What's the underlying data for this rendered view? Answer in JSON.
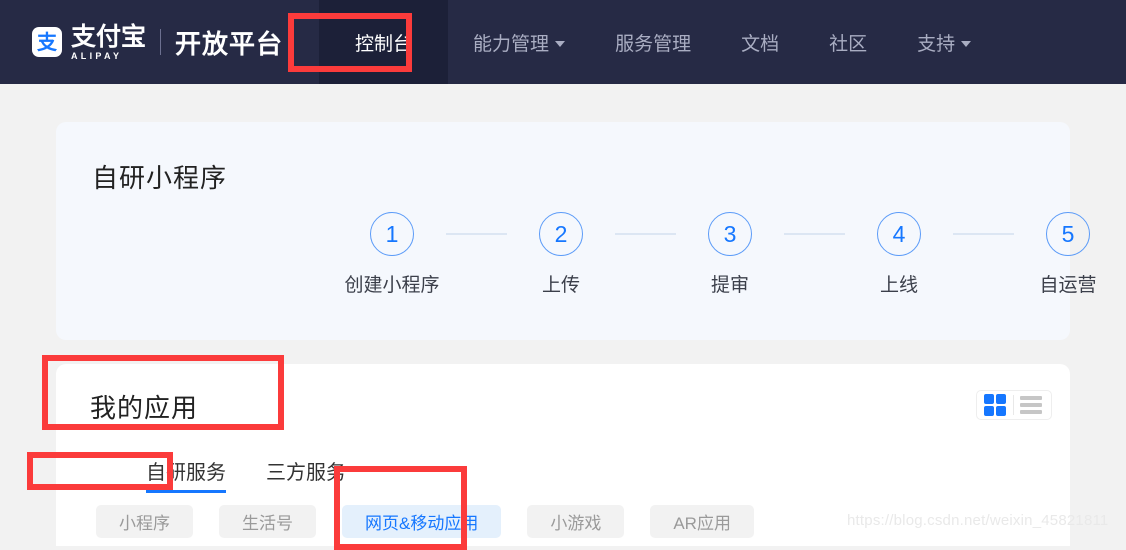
{
  "header": {
    "brand": {
      "logo_icon": "alipay-logo-icon",
      "logo_glyph": "支",
      "name_zh": "支付宝",
      "name_en": "ALIPAY",
      "platform": "开放平台"
    },
    "nav": [
      {
        "label": "控制台",
        "active": true,
        "has_caret": false
      },
      {
        "label": "能力管理",
        "active": false,
        "has_caret": true
      },
      {
        "label": "服务管理",
        "active": false,
        "has_caret": false
      },
      {
        "label": "文档",
        "active": false,
        "has_caret": false
      },
      {
        "label": "社区",
        "active": false,
        "has_caret": false
      },
      {
        "label": "支持",
        "active": false,
        "has_caret": true
      }
    ],
    "background_color": "#262a45",
    "active_background_color": "#1c2038"
  },
  "steps_card": {
    "title": "自研小程序",
    "background_color": "#f5f8fd",
    "accent_color": "#1677ff",
    "steps": [
      {
        "number": "1",
        "label": "创建小程序"
      },
      {
        "number": "2",
        "label": "上传"
      },
      {
        "number": "3",
        "label": "提审"
      },
      {
        "number": "4",
        "label": "上线"
      },
      {
        "number": "5",
        "label": "自运营"
      }
    ]
  },
  "apps_panel": {
    "title": "我的应用",
    "view_toggle": {
      "grid_icon": "grid-view-icon",
      "list_icon": "list-view-icon",
      "active": "grid"
    },
    "tabs": [
      {
        "label": "自研服务",
        "active": true
      },
      {
        "label": "三方服务",
        "active": false
      }
    ],
    "filters": [
      {
        "label": "小程序",
        "selected": false
      },
      {
        "label": "生活号",
        "selected": false
      },
      {
        "label": "网页&移动应用",
        "selected": true
      },
      {
        "label": "小游戏",
        "selected": false
      },
      {
        "label": "AR应用",
        "selected": false
      }
    ],
    "selected_filter_color": "#1677ff",
    "selected_filter_background": "#e4f0fc"
  },
  "annotations": {
    "color": "#fb3b3b",
    "boxes": [
      {
        "target": "控制台"
      },
      {
        "target": "我的应用"
      },
      {
        "target": "自研服务"
      },
      {
        "target": "网页&移动应用"
      }
    ]
  },
  "watermark": {
    "text": "https://blog.csdn.net/weixin_45821811"
  }
}
